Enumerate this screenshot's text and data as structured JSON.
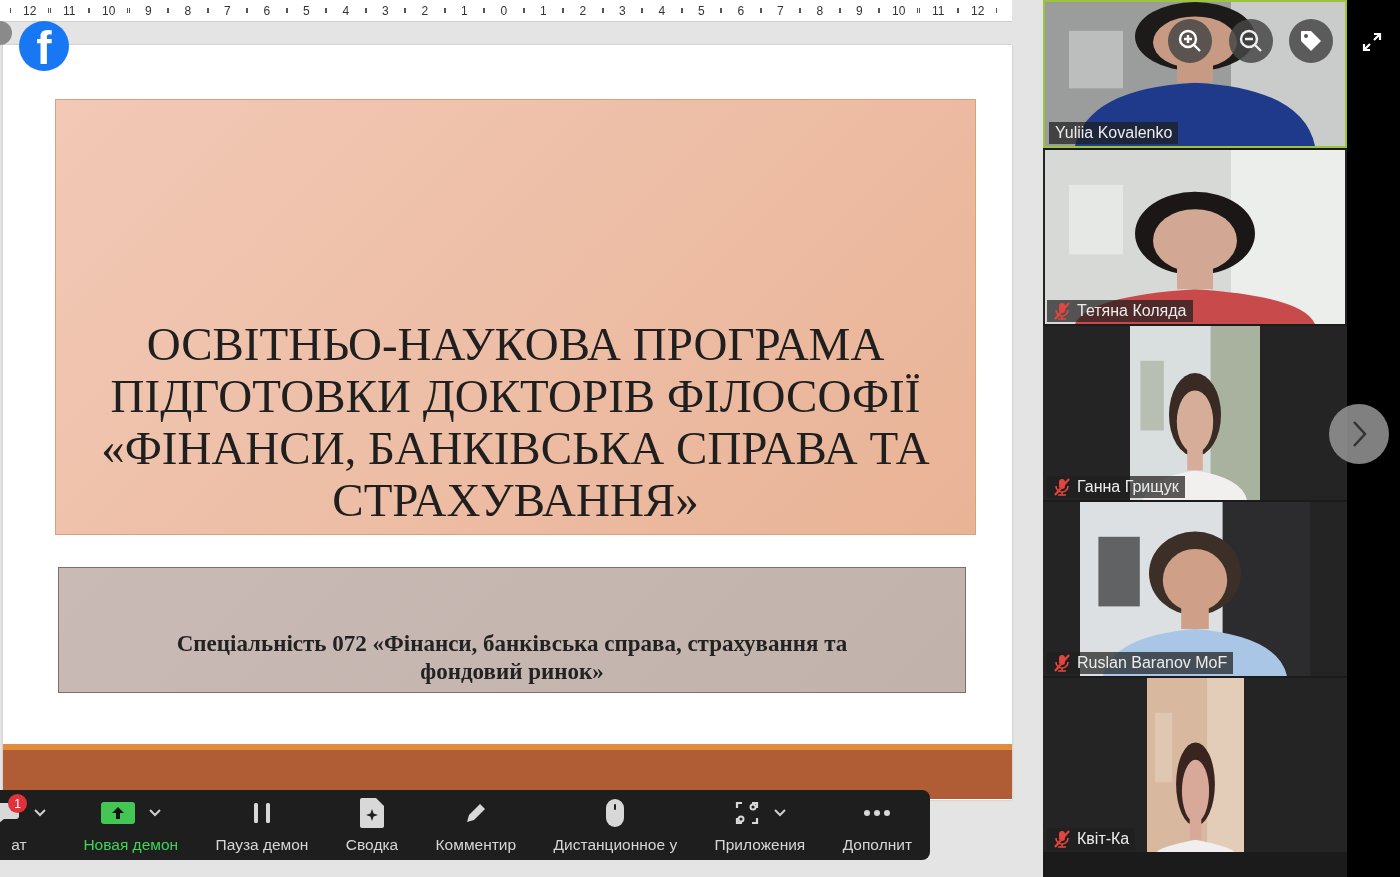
{
  "ruler": {
    "labels": [
      "12",
      "11",
      "10",
      "9",
      "8",
      "7",
      "6",
      "5",
      "4",
      "3",
      "2",
      "1",
      "0",
      "1",
      "2",
      "3",
      "4",
      "5",
      "6",
      "7",
      "8",
      "9",
      "10",
      "11",
      "12"
    ]
  },
  "logo_badge": {
    "text": "f"
  },
  "slide": {
    "title": "ОСВІТНЬО-НАУКОВА ПРОГРАМА\nПІДГОТОВКИ ДОКТОРІВ ФІЛОСОФІЇ\n«ФІНАНСИ, БАНКІВСЬКА СПРАВА ТА\nСТРАХУВАННЯ»",
    "subtitle": "Спеціальність 072 «Фінанси, банківська справа, страхування та фондовий ринок»"
  },
  "toolbar": {
    "items": [
      {
        "kind": "chat",
        "label": "ат",
        "active": false,
        "has_menu": true,
        "badge": "1"
      },
      {
        "kind": "share",
        "label": "Новая демон",
        "active": true,
        "has_menu": true
      },
      {
        "kind": "pause",
        "label": "Пауза демон",
        "active": false,
        "has_menu": false
      },
      {
        "kind": "summary",
        "label": "Сводка",
        "active": false,
        "has_menu": false
      },
      {
        "kind": "annotate",
        "label": "Комментир",
        "active": false,
        "has_menu": false
      },
      {
        "kind": "remote",
        "label": "Дистанционное у",
        "active": false,
        "has_menu": false
      },
      {
        "kind": "apps",
        "label": "Приложения",
        "active": false,
        "has_menu": true
      },
      {
        "kind": "more",
        "label": "Дополнит",
        "active": false,
        "has_menu": false
      }
    ]
  },
  "participants": [
    {
      "name": "Yuliia Kovalenko",
      "muted": false,
      "speaking": true
    },
    {
      "name": "Тетяна Коляда",
      "muted": true,
      "speaking": false
    },
    {
      "name": "Ганна Грищук",
      "muted": true,
      "speaking": false
    },
    {
      "name": "Ruslan Baranov MoF",
      "muted": true,
      "speaking": false
    },
    {
      "name": "Квіт-Ка",
      "muted": true,
      "speaking": false
    }
  ]
}
